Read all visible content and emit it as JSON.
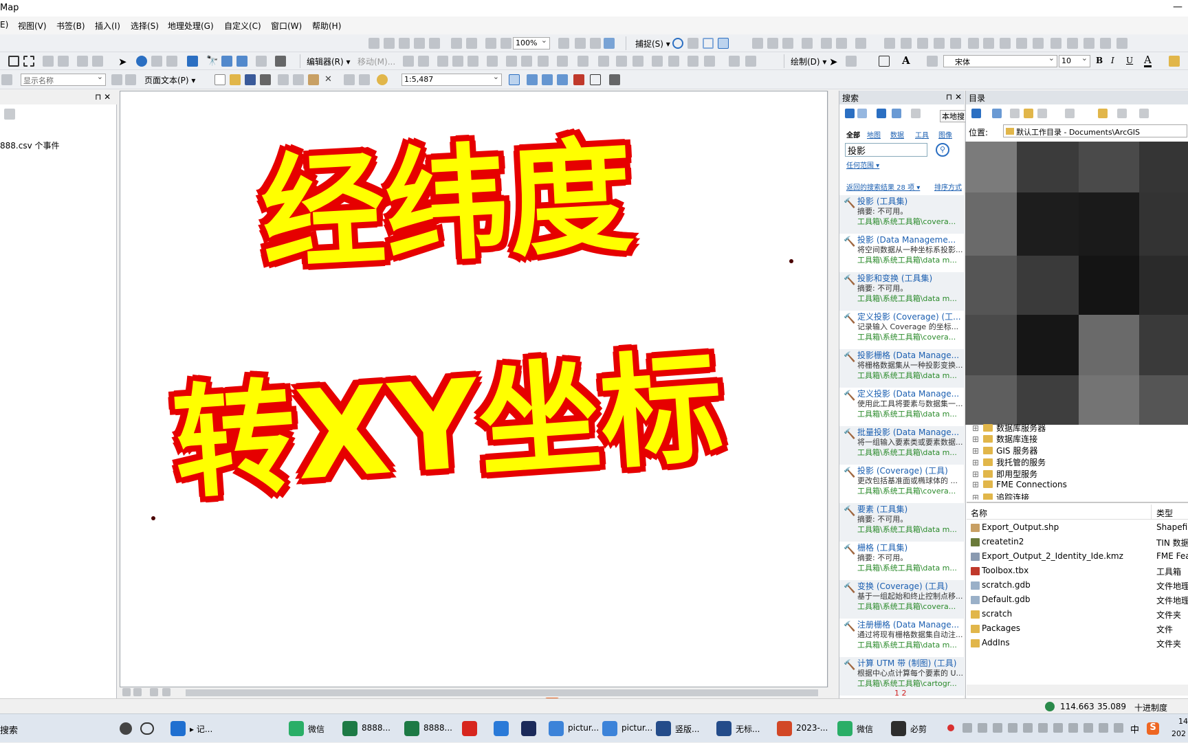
{
  "window": {
    "title": "Map",
    "min_glyph": "—"
  },
  "menu": [
    "E)",
    "视图(V)",
    "书签(B)",
    "插入(I)",
    "选择(S)",
    "地理处理(G)",
    "自定义(C)",
    "窗口(W)",
    "帮助(H)"
  ],
  "toolbar1": {
    "zoom_value": "100%",
    "snap_label": "捕捉(S) ▾"
  },
  "toolbar2": {
    "editor_label": "编辑器(R) ▾",
    "move_label": "移动(M)...",
    "draw_label": "绘制(D) ▾",
    "font_value": "宋体",
    "font_size": "10",
    "bold": "B",
    "italic": "I",
    "underline": "U",
    "font_color": "A"
  },
  "toolbar3": {
    "display_name": "显示名称",
    "page_text": "页面文本(P) ▾",
    "scale_value": "1:5,487"
  },
  "toc": {
    "pin": "⊓ ✕",
    "item": "888.csv 个事件"
  },
  "overlay": {
    "line1": "经纬度",
    "line2": "转XY坐标"
  },
  "search": {
    "title": "搜索",
    "pin": "⊓ ✕",
    "local_search": "本地搜",
    "filters": [
      "全部",
      "地图",
      "数据",
      "工具",
      "图像"
    ],
    "query": "投影",
    "scope": "任何范围 ▾",
    "result_count": "返回的搜索结果 28 项 ▾",
    "sort": "排序方式",
    "results": [
      {
        "title": "投影 (工具集)",
        "summary": "摘要: 不可用。",
        "path": "工具箱\\系统工具箱\\covera..."
      },
      {
        "title": "投影 (Data Manageme...",
        "summary": "将空间数据从一种坐标系投影...",
        "path": "工具箱\\系统工具箱\\data m..."
      },
      {
        "title": "投影和变换 (工具集)",
        "summary": "摘要: 不可用。",
        "path": "工具箱\\系统工具箱\\data m..."
      },
      {
        "title": "定义投影 (Coverage) (工...",
        "summary": "记录输入 Coverage 的坐标...",
        "path": "工具箱\\系统工具箱\\covera..."
      },
      {
        "title": "投影栅格 (Data Manage...",
        "summary": "将栅格数据集从一种投影变换...",
        "path": "工具箱\\系统工具箱\\data m..."
      },
      {
        "title": "定义投影 (Data Manage...",
        "summary": "使用此工具将要素与数据集一...",
        "path": "工具箱\\系统工具箱\\data m..."
      },
      {
        "title": "批量投影 (Data Manage...",
        "summary": "将一组输入要素类或要素数据...",
        "path": "工具箱\\系统工具箱\\data m..."
      },
      {
        "title": "投影 (Coverage) (工具)",
        "summary": "更改包括基准面或椭球体的 ...",
        "path": "工具箱\\系统工具箱\\covera..."
      },
      {
        "title": "要素 (工具集)",
        "summary": "摘要: 不可用。",
        "path": "工具箱\\系统工具箱\\data m..."
      },
      {
        "title": "栅格 (工具集)",
        "summary": "摘要: 不可用。",
        "path": "工具箱\\系统工具箱\\data m..."
      },
      {
        "title": "变换 (Coverage) (工具)",
        "summary": "基于一组起始和终止控制点移...",
        "path": "工具箱\\系统工具箱\\covera..."
      },
      {
        "title": "注册栅格 (Data Manage...",
        "summary": "通过将现有栅格数据集自动注...",
        "path": "工具箱\\系统工具箱\\data m..."
      },
      {
        "title": "计算 UTM 带 (制图) (工具)",
        "summary": "根据中心点计算每个要素的 U...",
        "path": "工具箱\\系统工具箱\\cartogr..."
      }
    ],
    "pages": "1 2"
  },
  "catalog": {
    "title": "目录",
    "location_label": "位置:",
    "location_value": "默认工作目录 - Documents\\ArcGIS",
    "tree": [
      "数据库服务器",
      "数据库连接",
      "GIS 服务器",
      "我托管的服务",
      "即用型服务",
      "FME Connections",
      "追踪连接"
    ],
    "col_name": "名称",
    "col_type": "类型",
    "rows": [
      {
        "name": "Export_Output.shp",
        "type": "Shapefi",
        "color": "#c8a064"
      },
      {
        "name": "createtin2",
        "type": "TIN 数据",
        "color": "#6a7a3a"
      },
      {
        "name": "Export_Output_2_Identity_Ide.kmz",
        "type": "FME Fea",
        "color": "#8a9ab0"
      },
      {
        "name": "Toolbox.tbx",
        "type": "工具箱",
        "color": "#c0392b"
      },
      {
        "name": "scratch.gdb",
        "type": "文件地理",
        "color": "#9ab0c8"
      },
      {
        "name": "Default.gdb",
        "type": "文件地理",
        "color": "#9ab0c8"
      },
      {
        "name": "scratch",
        "type": "文件夹",
        "color": "#e1b64a"
      },
      {
        "name": "Packages",
        "type": "文件",
        "color": "#e1b64a"
      },
      {
        "name": "AddIns",
        "type": "文件夹",
        "color": "#e1b64a"
      }
    ]
  },
  "status": {
    "x": "114.663",
    "y": "35.089",
    "unit": "十进制度"
  },
  "ime": {
    "lang": "中",
    "punct": "•,"
  },
  "taskbar": {
    "search": "搜索",
    "items": [
      {
        "label": "▸ 记...",
        "color": "#1f6fd0"
      },
      {
        "label": "微信",
        "color": "#2aae67"
      },
      {
        "label": "8888...",
        "color": "#1d7a45"
      },
      {
        "label": "8888...",
        "color": "#1d7a45"
      },
      {
        "label": "",
        "color": "#d7261e"
      },
      {
        "label": "",
        "color": "#2a7ad8"
      },
      {
        "label": "",
        "color": "#1b2a5a"
      },
      {
        "label": "pictur...",
        "color": "#3c83d9"
      },
      {
        "label": "pictur...",
        "color": "#3c83d9"
      },
      {
        "label": "竖版...",
        "color": "#244c8a"
      },
      {
        "label": "无标...",
        "color": "#244c8a"
      },
      {
        "label": "2023-...",
        "color": "#d24726"
      },
      {
        "label": "微信",
        "color": "#2aae67"
      },
      {
        "label": "必剪",
        "color": "#2d2d2d"
      }
    ],
    "tray_lang": "中",
    "time": "14",
    "date": "202"
  }
}
